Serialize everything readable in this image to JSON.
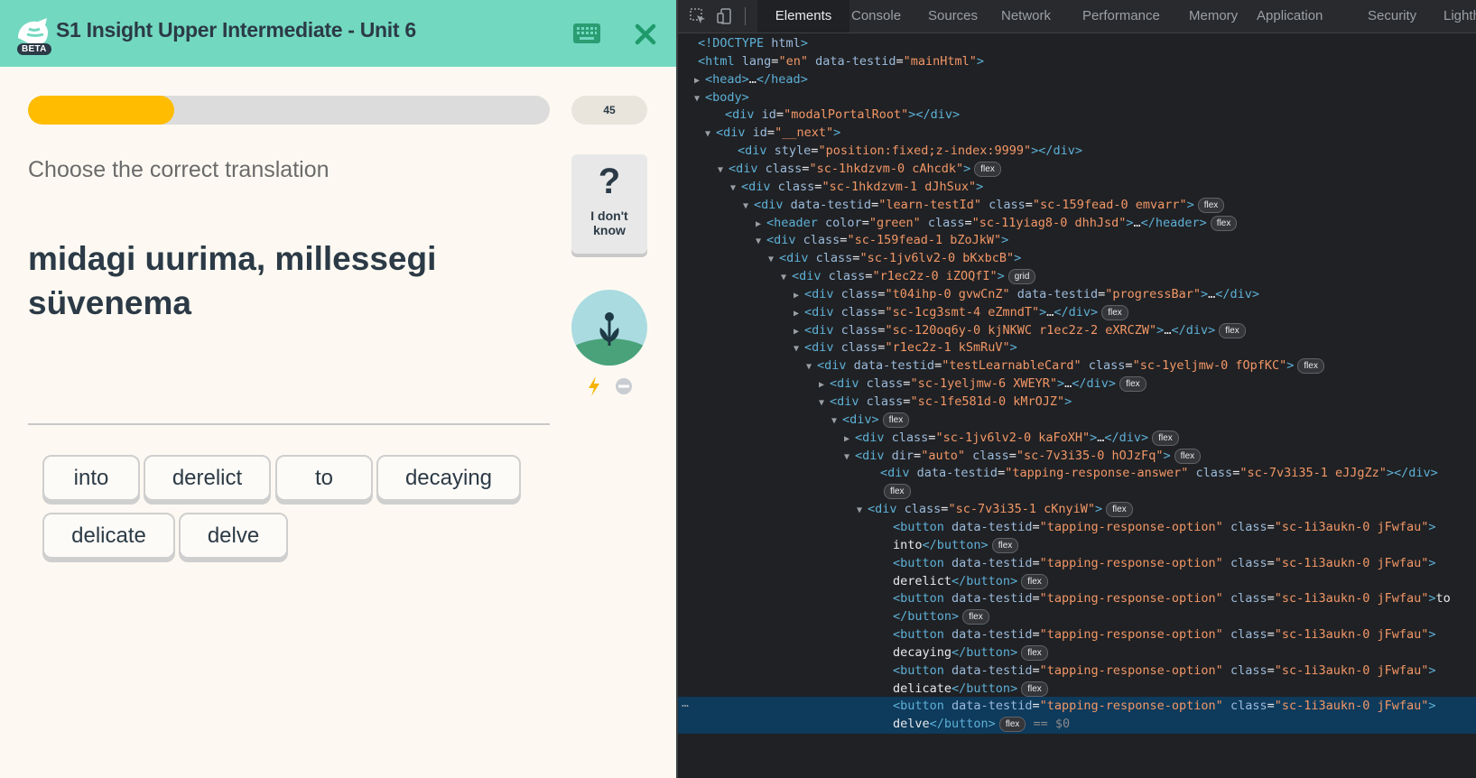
{
  "app": {
    "beta_badge": "BETA",
    "course_title": "S1 Insight Upper Intermediate - Unit 6",
    "progress_fraction": 0.28,
    "points": "45",
    "instruction": "Choose the correct translation",
    "dont_know": {
      "symbol": "?",
      "label_line1": "I don't",
      "label_line2": "know"
    },
    "prompt": "midagi uurima, millessegi süvenema",
    "options": [
      "into",
      "derelict",
      "to",
      "decaying",
      "delicate",
      "delve"
    ],
    "colors": {
      "header": "#72d8c0",
      "progress": "#ffbc00",
      "background": "#fdf9f2"
    }
  },
  "devtools": {
    "tabs": [
      "Elements",
      "Console",
      "Sources",
      "Network",
      "Performance",
      "Memory",
      "Application",
      "Security",
      "Lighthc"
    ],
    "active_tab": "Elements",
    "lines": [
      "<!DOCTYPE html>",
      "<html lang=\"en\" data-testid=\"mainHtml\">",
      "<head>…</head>",
      "<body>",
      "<div id=\"modalPortalRoot\"></div>",
      "<div id=\"__next\">",
      "<div style=\"position:fixed;z-index:9999\"></div>",
      "<div class=\"sc-1hkdzvm-0 cAhcdk\">",
      "<div class=\"sc-1hkdzvm-1 dJhSux\">",
      "<div data-testid=\"learn-testId\" class=\"sc-159fead-0 emvarr\">",
      "<header color=\"green\" class=\"sc-11yiag8-0 dhhJsd\">…</header>",
      "<div class=\"sc-159fead-1 bZoJkW\">",
      "<div class=\"sc-1jv6lv2-0 bKxbcB\">",
      "<div class=\"r1ec2z-0 iZOQfI\">",
      "<div class=\"t04ihp-0 gvwCnZ\" data-testid=\"progressBar\">…</div>",
      "<div class=\"sc-1cg3smt-4 eZmndT\">…</div>",
      "<div class=\"sc-120oq6y-0 kjNKWC r1ec2z-2 eXRCZW\">…</div>",
      "<div class=\"r1ec2z-1 kSmRuV\">",
      "<div data-testid=\"testLearnableCard\" class=\"sc-1yeljmw-0 fOpfKC\">",
      "<div class=\"sc-1yeljmw-6 XWEYR\">…</div>",
      "<div class=\"sc-1fe581d-0 kMrOJZ\">",
      "<div>",
      "<div class=\"sc-1jv6lv2-0 kaFoXH\">…</div>",
      "<div dir=\"auto\" class=\"sc-7v3i35-0 hOJzFq\">",
      "<div data-testid=\"tapping-response-answer\" class=\"sc-7v3i35-1 eJJgZz\"></div>",
      "",
      "<div class=\"sc-7v3i35-1 cKnyiW\">",
      "<button data-testid=\"tapping-response-option\" class=\"sc-1i3aukn-0 jFwfau\">",
      "into</button>",
      "<button data-testid=\"tapping-response-option\" class=\"sc-1i3aukn-0 jFwfau\">",
      "derelict</button>",
      "<button data-testid=\"tapping-response-option\" class=\"sc-1i3aukn-0 jFwfau\">to",
      "</button>",
      "<button data-testid=\"tapping-response-option\" class=\"sc-1i3aukn-0 jFwfau\">",
      "decaying</button>",
      "<button data-testid=\"tapping-response-option\" class=\"sc-1i3aukn-0 jFwfau\">",
      "delicate</button>",
      "<button data-testid=\"tapping-response-option\" class=\"sc-1i3aukn-0 jFwfau\">",
      "delve</button>"
    ],
    "badges": {
      "flex": "flex",
      "grid": "grid"
    },
    "selected_marker": "== $0",
    "ellipsis": "…"
  }
}
